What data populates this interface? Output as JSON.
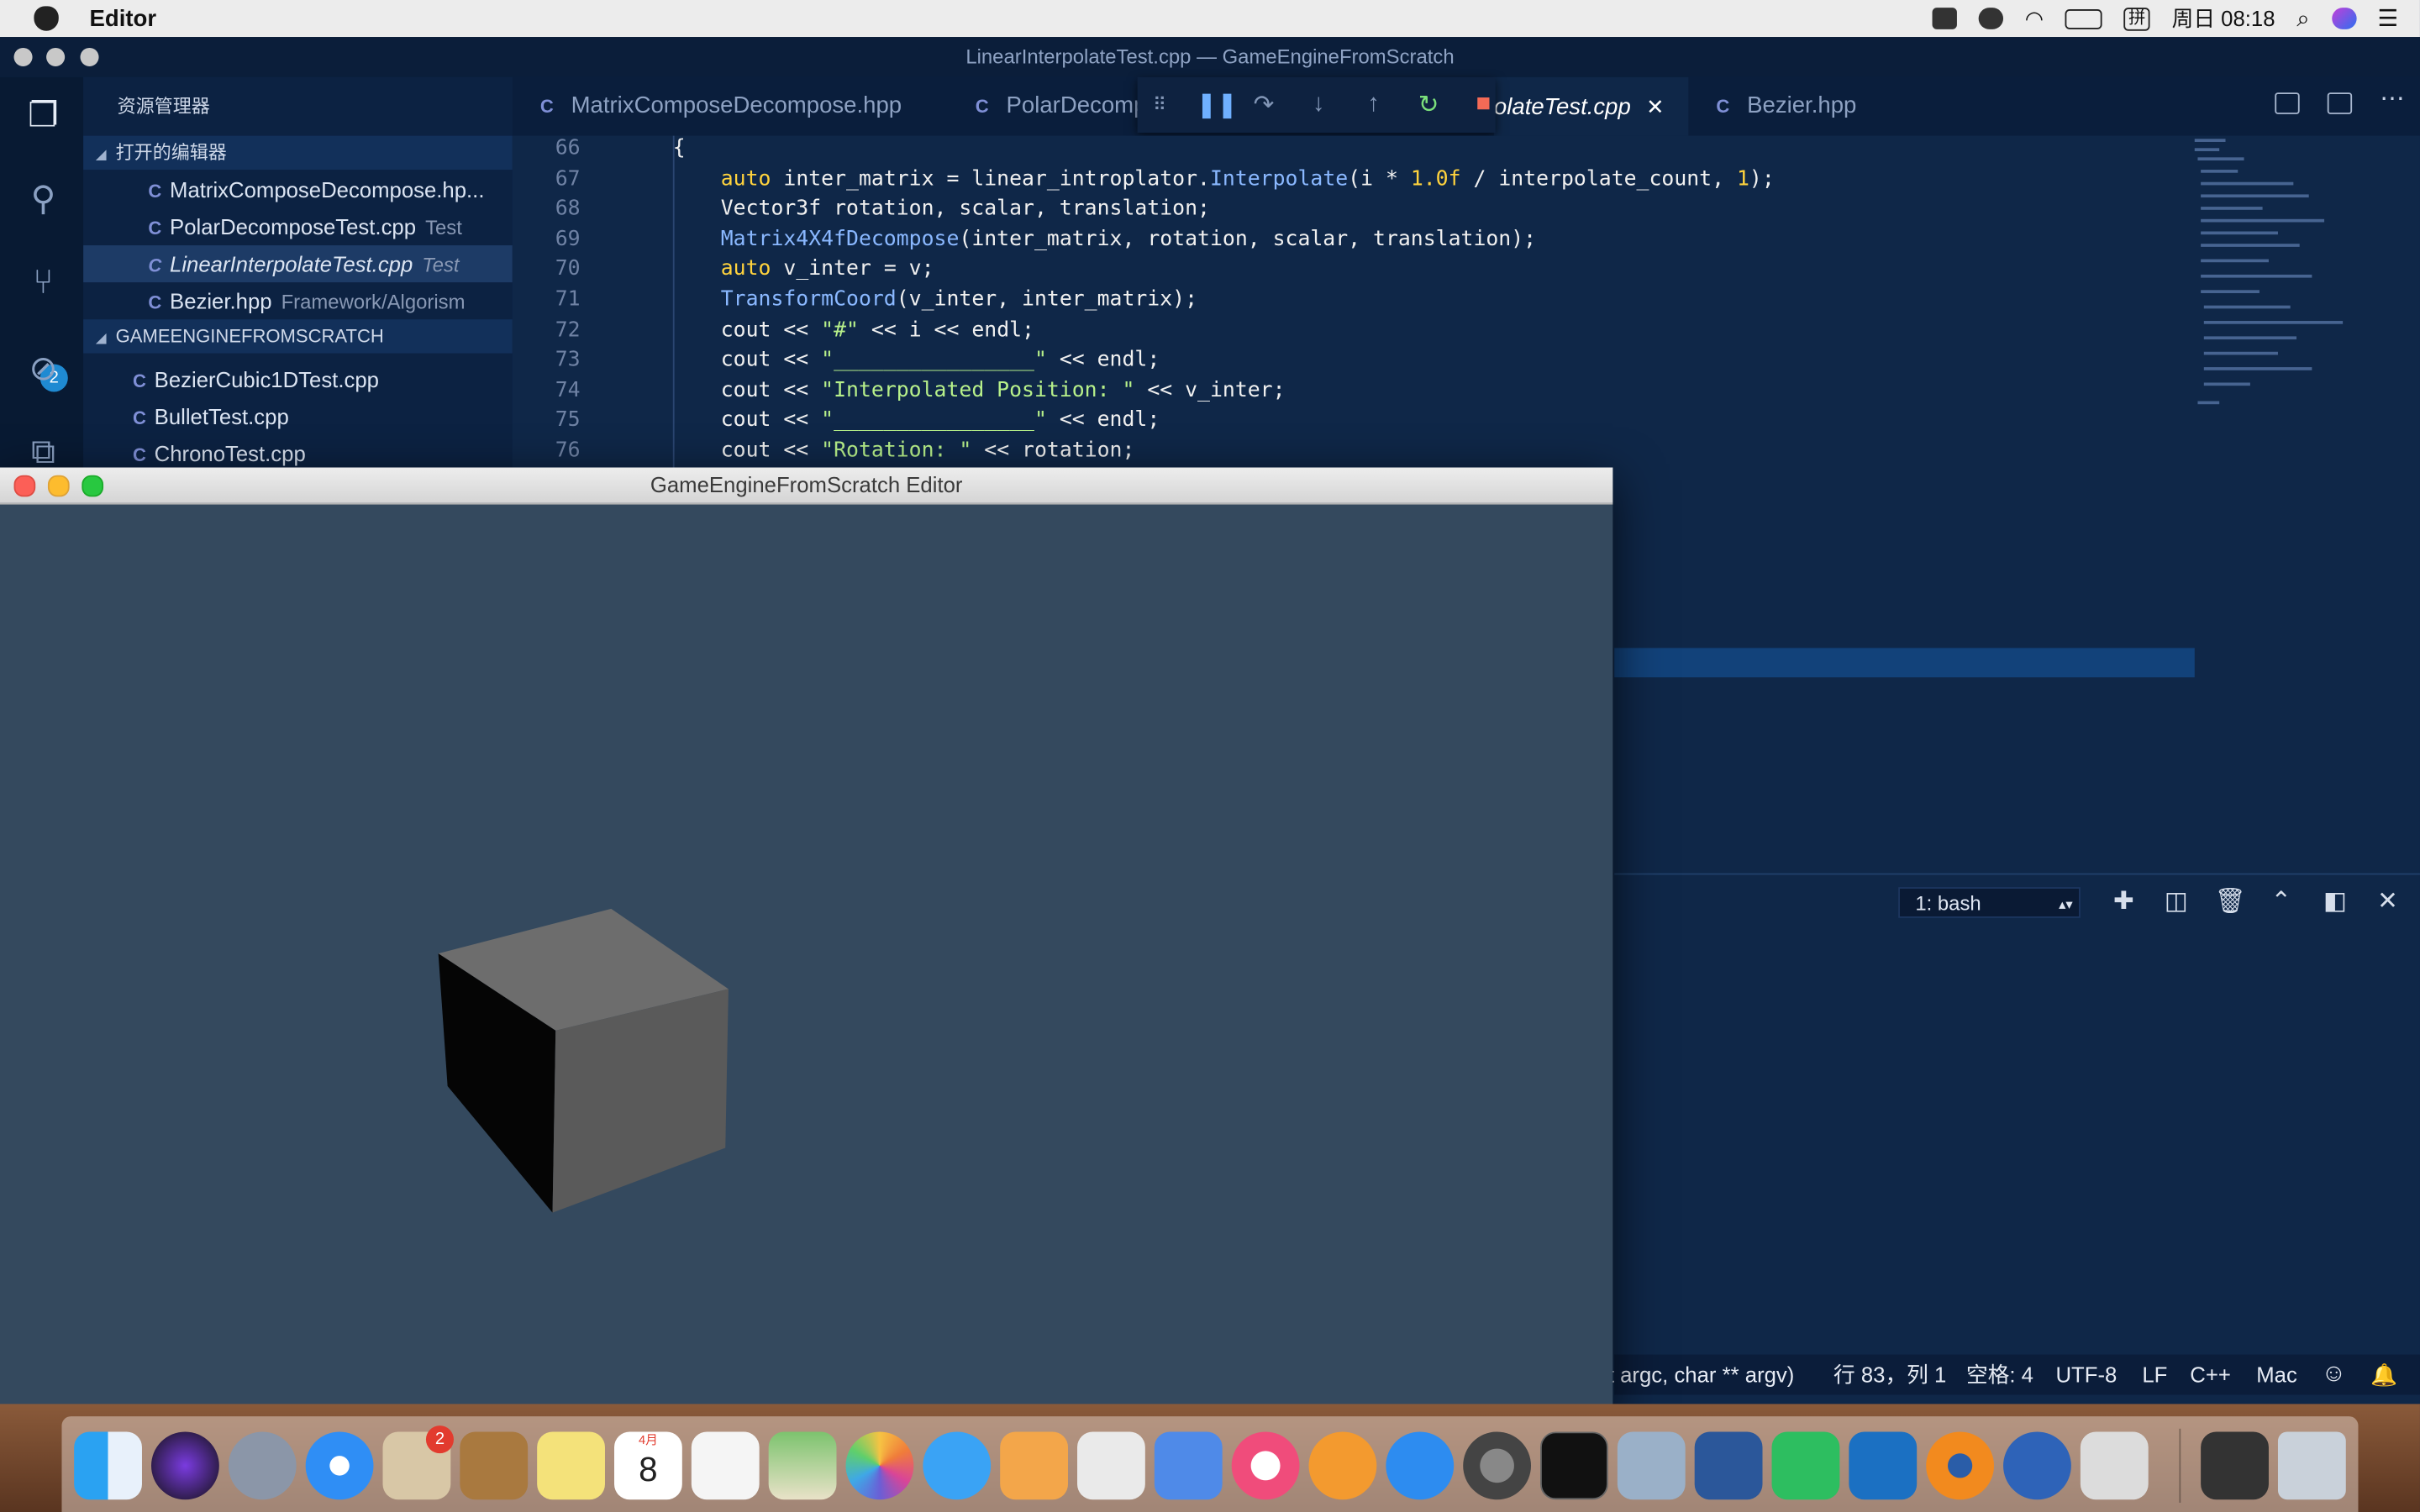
{
  "menubar": {
    "app_name": "Editor",
    "clock": "周日 08:18",
    "input_method": "拼"
  },
  "window": {
    "title": "LinearInterpolateTest.cpp — GameEngineFromScratch"
  },
  "activity": {
    "scm_badge": "2"
  },
  "sidebar": {
    "header": "资源管理器",
    "open_editors_title": "打开的编辑器",
    "open_editors": [
      {
        "name": "MatrixComposeDecompose.hp...",
        "desc": ""
      },
      {
        "name": "PolarDecomposeTest.cpp",
        "desc": "Test"
      },
      {
        "name": "LinearInterpolateTest.cpp",
        "desc": "Test"
      },
      {
        "name": "Bezier.hpp",
        "desc": "Framework/Algorism"
      }
    ],
    "project_title": "GAMEENGINEFROMSCRATCH",
    "files": [
      "BezierCubic1DTest.cpp",
      "BulletTest.cpp",
      "ChronoTest.cpp"
    ]
  },
  "tabs": [
    {
      "label": "MatrixComposeDecompose.hpp"
    },
    {
      "label": "PolarDecomp"
    },
    {
      "label": "olateTest.cpp"
    },
    {
      "label": "Bezier.hpp"
    }
  ],
  "tab_close": "✕",
  "editor": {
    "line_numbers": [
      "66",
      "67",
      "68",
      "69",
      "70",
      "71",
      "72",
      "73",
      "74",
      "75",
      "76"
    ],
    "lines": {
      "l66": "{",
      "l67_kw": "auto",
      "l67_a": " inter_matrix = linear_introplator.",
      "l67_fn": "Interpolate",
      "l67_b": "(i * ",
      "l67_num": "1.0f",
      "l67_c": " / interpolate_count, ",
      "l67_num2": "1",
      "l67_d": ");",
      "l68": "Vector3f rotation, scalar, translation;",
      "l69_fn": "Matrix4X4fDecompose",
      "l69_a": "(inter_matrix, rotation, scalar, translation);",
      "l70_kw": "auto",
      "l70_a": " v_inter = v;",
      "l71_fn": "TransformCoord",
      "l71_a": "(v_inter, inter_matrix);",
      "l72_a": "cout << ",
      "l72_str": "\"#\"",
      "l72_b": " << i << endl;",
      "l73_a": "cout << ",
      "l73_str": "\"________________\"",
      "l73_b": " << endl;",
      "l74_a": "cout << ",
      "l74_str": "\"Interpolated Position: \"",
      "l74_b": " << v_inter;",
      "l75_a": "cout << ",
      "l75_str": "\"________________\"",
      "l75_b": " << endl;",
      "l76_a": "cout << ",
      "l76_str": "\"Rotation: \"",
      "l76_b": " << rotation;"
    }
  },
  "terminal": {
    "selector": "1: bash"
  },
  "statusbar": {
    "signature": "t argc, char ** argv)",
    "position": "行 83，列 1",
    "spaces": "空格: 4",
    "encoding": "UTF-8",
    "eol": "LF",
    "language": "C++",
    "platform": "Mac"
  },
  "game_window": {
    "title": "GameEngineFromScratch Editor"
  },
  "dock": {
    "mail_badge": "2",
    "calendar_month": "4月",
    "calendar_day": "8"
  },
  "colors": {
    "editor_bg": "#0f2748",
    "game_bg": "#34495e",
    "cube_top": "#6d6d6d"
  }
}
